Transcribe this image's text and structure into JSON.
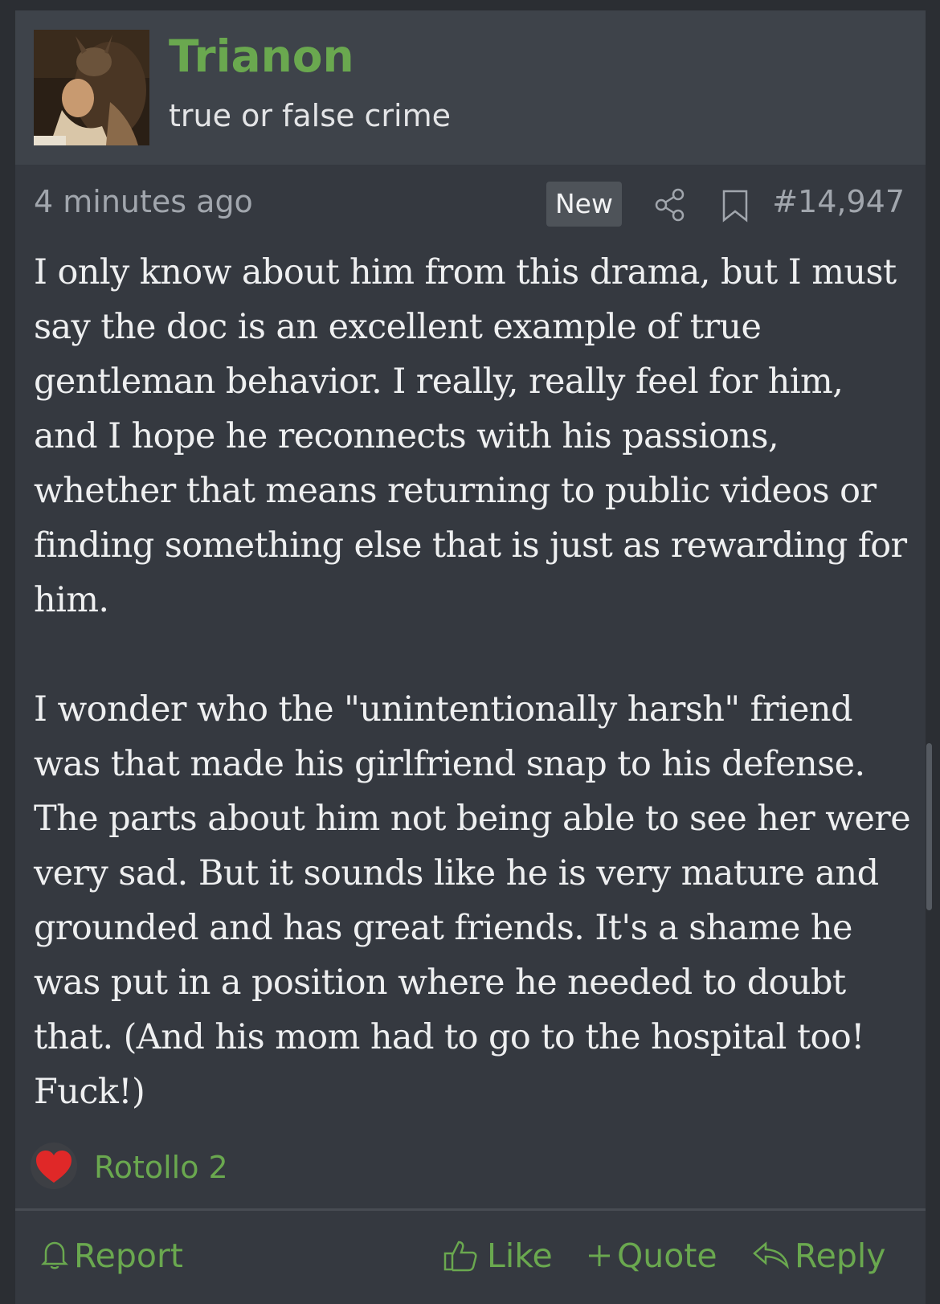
{
  "user": {
    "name": "Trianon",
    "title": "true or false crime"
  },
  "meta": {
    "time": "4 minutes ago",
    "badge": "New",
    "post_number": "#14,947"
  },
  "body": {
    "paragraph1": "I only know about him from this drama, but I must say the doc is an excellent example of true gentleman behavior. I really, really feel for him, and I hope he reconnects with his passions, whether that means returning to public videos or finding something else that is just as rewarding for him.",
    "paragraph2": "I wonder who the \"unintentionally harsh\" friend was that made his girlfriend snap to his defense. The parts about him not being able to see her were very sad. But it sounds like he is very mature and grounded and has great friends. It's a shame he was put in a position where he needed to doubt that. (And his mom had to go to the hospital too! Fuck!)"
  },
  "reactions": {
    "icon": "heart-icon",
    "label": "Rotollo 2"
  },
  "actions": {
    "report": "Report",
    "like": "Like",
    "quote": "Quote",
    "reply": "Reply"
  },
  "colors": {
    "accent": "#6aa84f",
    "background": "#2b2e33",
    "post_bg": "#353940",
    "header_bg": "#3e434a",
    "text": "#eeeff0",
    "muted": "#a1a6ad",
    "heart": "#e02828"
  }
}
